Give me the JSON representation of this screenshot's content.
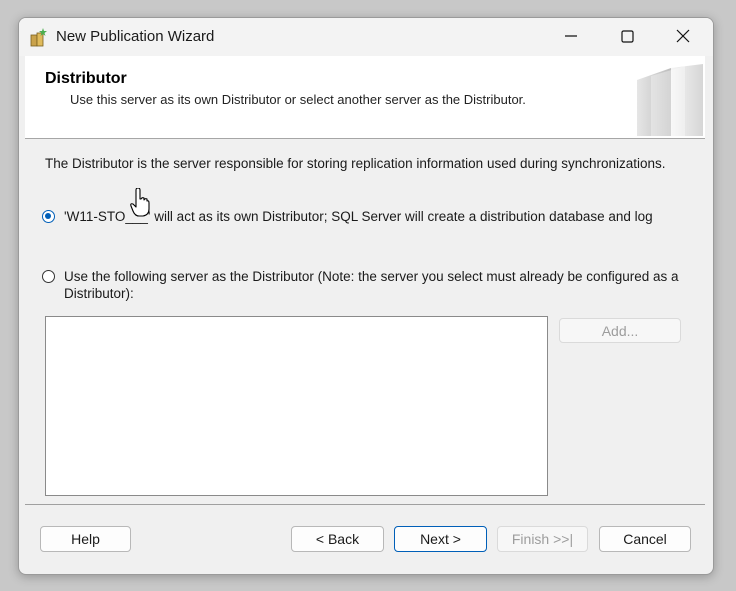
{
  "window": {
    "title": "New Publication Wizard"
  },
  "title_controls": {
    "minimize_icon": "minimize-icon",
    "maximize_icon": "maximize-icon",
    "close_icon": "close-icon"
  },
  "header": {
    "title": "Distributor",
    "subtitle": "Use this server as its own Distributor or select another server as the Distributor."
  },
  "content": {
    "description": "The Distributor is the server responsible for storing replication information used during synchronizations.",
    "options": [
      {
        "label": "'W11-STO___' will act as its own Distributor; SQL Server will create a distribution database and log",
        "selected": true
      },
      {
        "label": "Use the following server as the Distributor (Note: the server you select must already be configured as a Distributor):",
        "selected": false
      }
    ],
    "add_button": "Add..."
  },
  "footer": {
    "help": "Help",
    "back": "< Back",
    "next": "Next >",
    "finish": "Finish >>|",
    "cancel": "Cancel"
  },
  "colors": {
    "accent": "#005fb8",
    "window_bg": "#f0f0f0"
  }
}
